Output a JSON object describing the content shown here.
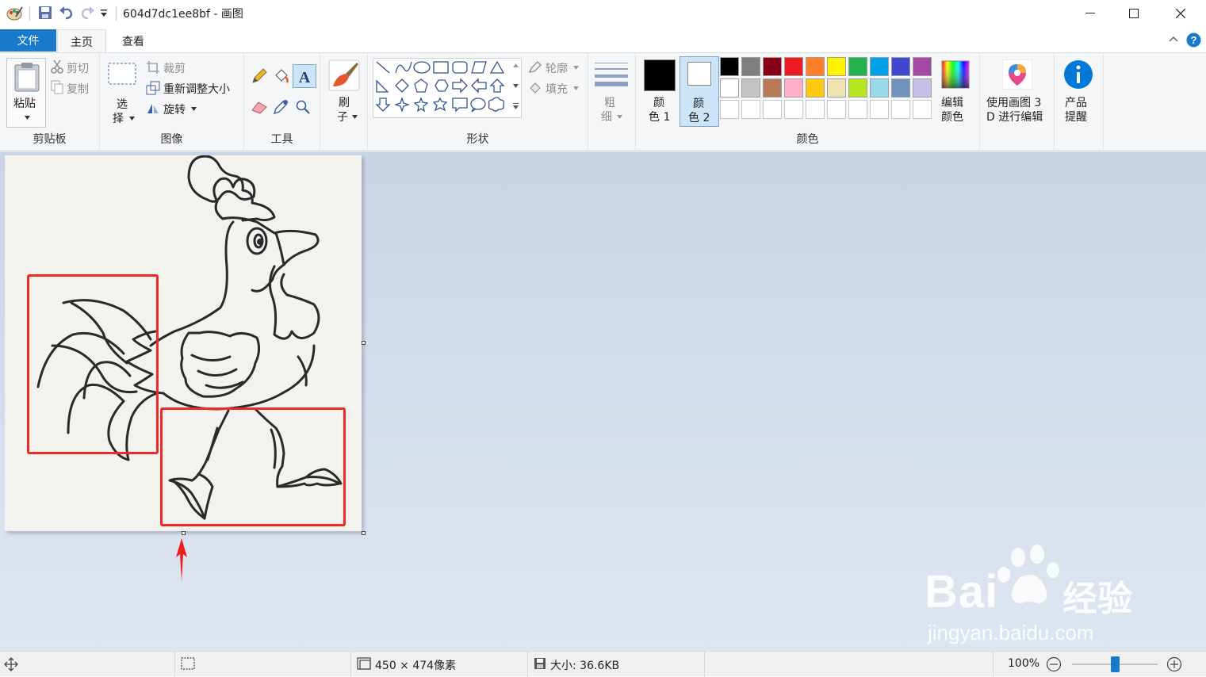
{
  "window": {
    "title": "604d7dc1ee8bf - 画图"
  },
  "menu": {
    "file": "文件",
    "home": "主页",
    "view": "查看"
  },
  "clipboard": {
    "paste": "粘贴",
    "cut": "剪切",
    "copy": "复制",
    "label": "剪贴板"
  },
  "image": {
    "select_1": "选",
    "select_2": "择",
    "crop": "裁剪",
    "resize": "重新调整大小",
    "rotate": "旋转",
    "label": "图像"
  },
  "tools": {
    "label": "工具"
  },
  "brush": {
    "line1": "刷",
    "line2": "子"
  },
  "shapes": {
    "outline": "轮廓",
    "fill": "填充",
    "label": "形状"
  },
  "size": {
    "line1": "粗",
    "line2": "细"
  },
  "colors": {
    "color1_l1": "颜",
    "color1_l2": "色 1",
    "color2_l1": "颜",
    "color2_l2": "色 2",
    "edit_l1": "编辑",
    "edit_l2": "颜色",
    "label": "颜色",
    "palette_row1": [
      "#000000",
      "#7f7f7f",
      "#880015",
      "#ed1c24",
      "#ff7f27",
      "#fff200",
      "#22b14c",
      "#00a2e8",
      "#3f48cc",
      "#a349a4"
    ],
    "palette_row2": [
      "#ffffff",
      "#c3c3c3",
      "#b97a57",
      "#ffaec9",
      "#ffc90e",
      "#efe4b0",
      "#b5e61d",
      "#99d9ea",
      "#7092be",
      "#c8bfe7"
    ]
  },
  "paint3d": {
    "line1": "使用画图 3",
    "line2": "D 进行编辑"
  },
  "alert": {
    "line1": "产品",
    "line2": "提醒"
  },
  "status": {
    "dimensions": "450 × 474像素",
    "size": "大小: 36.6KB",
    "zoom": "100%",
    "zoom_level": 0.5
  },
  "watermark": {
    "brand": "Bai",
    "suffix": "经验",
    "url": "jingyan.baidu.com"
  }
}
